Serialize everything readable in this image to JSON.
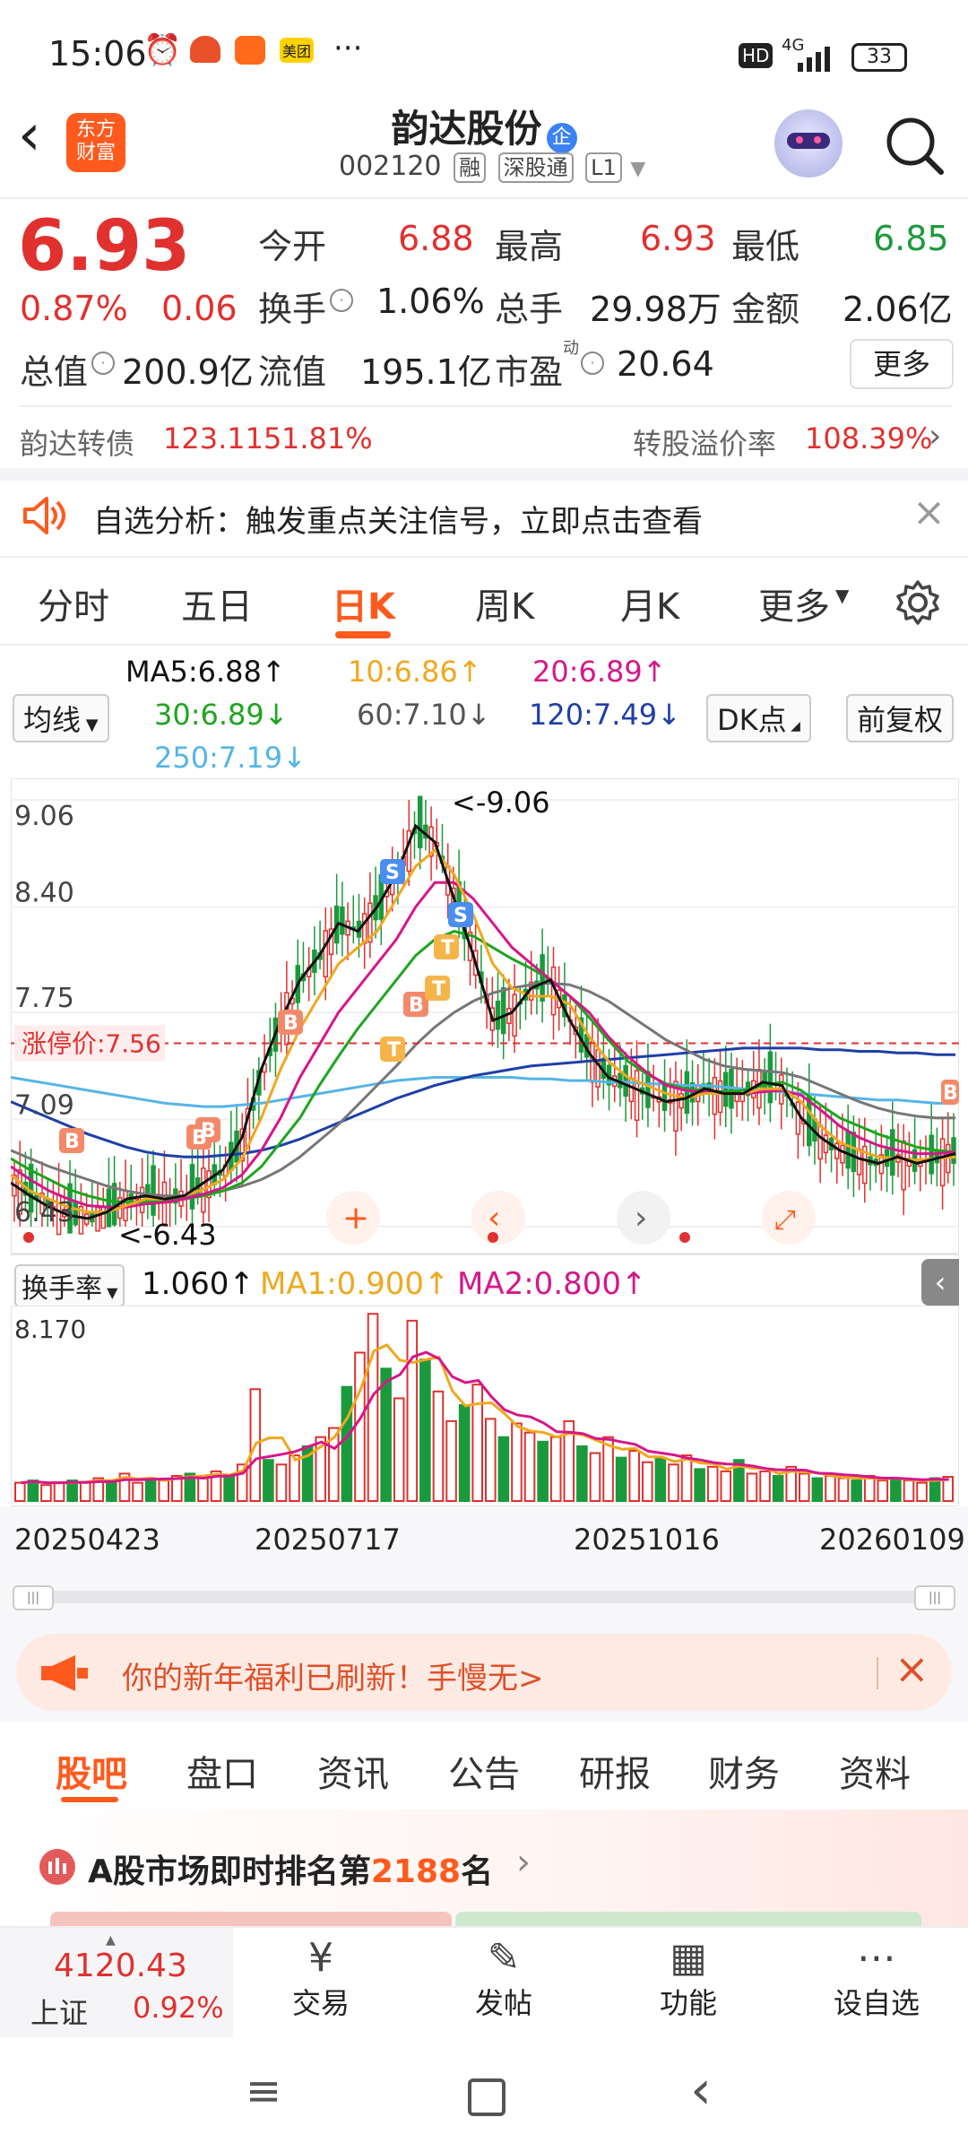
{
  "status_bar": {
    "time": "15:06",
    "meituan": "美团",
    "more": "···",
    "hd": "HD",
    "network": "4G",
    "battery": "33"
  },
  "header": {
    "logo_line1": "东方",
    "logo_line2": "财富",
    "title": "韵达股份",
    "badge": "企",
    "code": "002120",
    "tags": [
      "融",
      "深股通",
      "L1"
    ]
  },
  "quote": {
    "price": "6.93",
    "change_pct": "0.87%",
    "change": "0.06",
    "open_label": "今开",
    "open": "6.88",
    "high_label": "最高",
    "high": "6.93",
    "low_label": "最低",
    "low": "6.85",
    "turnover_label": "换手",
    "turnover": "1.06%",
    "volume_label": "总手",
    "volume": "29.98万",
    "amount_label": "金额",
    "amount": "2.06亿",
    "mktcap_label": "总值",
    "mktcap": "200.9亿",
    "float_label": "流值",
    "float": "195.1亿",
    "pe_label": "市盈",
    "pe_sup": "动",
    "pe": "20.64",
    "more_button": "更多"
  },
  "bond": {
    "name": "韵达转债",
    "price": "123.115",
    "pct": "1.81%",
    "premium_label": "转股溢价率",
    "premium": "108.39%"
  },
  "notice": {
    "text": "自选分析：触发重点关注信号，立即点击查看"
  },
  "period_tabs": [
    "分时",
    "五日",
    "日K",
    "周K",
    "月K",
    "更多"
  ],
  "active_tab": "日K",
  "ma_legend": {
    "select": "均线",
    "ma5": "MA5:6.88↑",
    "ma10": "10:6.86↑",
    "ma20": "20:6.89↑",
    "ma30": "30:6.89↓",
    "ma60": "60:7.10↓",
    "ma120": "120:7.49↓",
    "ma250": "250:7.19↓",
    "dk_button": "DK点",
    "adjust_button": "前复权"
  },
  "colors": {
    "ma5": "#111111",
    "ma10": "#f0a81e",
    "ma20": "#d6178a",
    "ma30": "#1ea51e",
    "ma60": "#777777",
    "ma120": "#1f3fa8",
    "ma250": "#55b5e6",
    "accent": "#ff5a1e",
    "up": "#e0312f",
    "down": "#1a9a3c"
  },
  "chart_data": [
    {
      "type": "candlestick",
      "y_ticks": [
        "9.06",
        "8.40",
        "7.75",
        "7.09",
        "6.43"
      ],
      "ylim": [
        6.43,
        9.06
      ],
      "limit_label": "涨停价:7.56",
      "limit_price": 7.56,
      "max_label": "<-9.06",
      "min_label": "<-6.43",
      "x_labels": [
        "20250423",
        "20250717",
        "20251016",
        "20260109"
      ],
      "series": [
        {
          "name": "MA5",
          "color": "#111111",
          "values": [
            6.7,
            6.62,
            6.55,
            6.5,
            6.48,
            6.52,
            6.6,
            6.62,
            6.6,
            6.62,
            6.7,
            6.78,
            6.98,
            7.4,
            7.7,
            7.95,
            8.1,
            8.3,
            8.25,
            8.4,
            8.6,
            8.9,
            8.8,
            8.45,
            8.1,
            7.7,
            7.75,
            7.9,
            7.95,
            7.7,
            7.5,
            7.35,
            7.3,
            7.25,
            7.2,
            7.22,
            7.28,
            7.25,
            7.25,
            7.32,
            7.3,
            7.1,
            6.98,
            6.9,
            6.85,
            6.82,
            6.86,
            6.82,
            6.85,
            6.88
          ]
        },
        {
          "name": "10",
          "color": "#f0a81e",
          "values": [
            6.75,
            6.65,
            6.6,
            6.55,
            6.52,
            6.52,
            6.56,
            6.6,
            6.6,
            6.62,
            6.66,
            6.72,
            6.85,
            7.1,
            7.4,
            7.65,
            7.85,
            8.05,
            8.15,
            8.25,
            8.45,
            8.65,
            8.75,
            8.6,
            8.35,
            8.05,
            7.9,
            7.85,
            7.85,
            7.8,
            7.6,
            7.45,
            7.35,
            7.3,
            7.25,
            7.22,
            7.25,
            7.25,
            7.25,
            7.28,
            7.28,
            7.2,
            7.05,
            6.95,
            6.9,
            6.86,
            6.85,
            6.84,
            6.85,
            6.86
          ]
        },
        {
          "name": "20",
          "color": "#d6178a",
          "values": [
            6.8,
            6.72,
            6.65,
            6.6,
            6.56,
            6.55,
            6.55,
            6.57,
            6.58,
            6.6,
            6.63,
            6.67,
            6.75,
            6.9,
            7.1,
            7.35,
            7.55,
            7.75,
            7.9,
            8.05,
            8.2,
            8.4,
            8.55,
            8.55,
            8.45,
            8.3,
            8.15,
            8.05,
            7.95,
            7.85,
            7.75,
            7.6,
            7.48,
            7.38,
            7.3,
            7.27,
            7.26,
            7.25,
            7.25,
            7.26,
            7.27,
            7.24,
            7.15,
            7.05,
            6.98,
            6.93,
            6.9,
            6.88,
            6.88,
            6.89
          ]
        },
        {
          "name": "30",
          "color": "#1ea51e",
          "values": [
            6.85,
            6.78,
            6.72,
            6.66,
            6.62,
            6.59,
            6.58,
            6.58,
            6.59,
            6.6,
            6.62,
            6.65,
            6.7,
            6.8,
            6.95,
            7.1,
            7.3,
            7.48,
            7.65,
            7.8,
            7.95,
            8.1,
            8.2,
            8.25,
            8.22,
            8.15,
            8.08,
            8.02,
            7.95,
            7.85,
            7.72,
            7.58,
            7.45,
            7.37,
            7.31,
            7.28,
            7.27,
            7.26,
            7.27,
            7.3,
            7.32,
            7.27,
            7.18,
            7.1,
            7.05,
            7.0,
            6.96,
            6.92,
            6.9,
            6.89
          ]
        },
        {
          "name": "60",
          "color": "#777777",
          "values": [
            6.9,
            6.85,
            6.8,
            6.76,
            6.72,
            6.68,
            6.65,
            6.63,
            6.62,
            6.62,
            6.63,
            6.65,
            6.68,
            6.72,
            6.78,
            6.86,
            6.96,
            7.06,
            7.18,
            7.3,
            7.42,
            7.55,
            7.66,
            7.75,
            7.82,
            7.87,
            7.9,
            7.92,
            7.93,
            7.92,
            7.88,
            7.82,
            7.74,
            7.66,
            7.58,
            7.52,
            7.46,
            7.42,
            7.4,
            7.39,
            7.38,
            7.35,
            7.3,
            7.25,
            7.2,
            7.16,
            7.13,
            7.11,
            7.1,
            7.1
          ]
        },
        {
          "name": "120",
          "color": "#1f3fa8",
          "values": [
            7.2,
            7.15,
            7.1,
            7.05,
            7.0,
            6.96,
            6.92,
            6.89,
            6.87,
            6.86,
            6.86,
            6.87,
            6.88,
            6.9,
            6.93,
            6.97,
            7.02,
            7.07,
            7.12,
            7.17,
            7.22,
            7.26,
            7.3,
            7.33,
            7.36,
            7.38,
            7.4,
            7.42,
            7.43,
            7.44,
            7.45,
            7.46,
            7.47,
            7.48,
            7.49,
            7.5,
            7.51,
            7.52,
            7.53,
            7.53,
            7.53,
            7.53,
            7.52,
            7.52,
            7.51,
            7.51,
            7.5,
            7.5,
            7.49,
            7.49
          ]
        },
        {
          "name": "250",
          "color": "#55b5e6",
          "values": [
            7.35,
            7.33,
            7.31,
            7.29,
            7.27,
            7.25,
            7.23,
            7.21,
            7.19,
            7.18,
            7.17,
            7.17,
            7.18,
            7.19,
            7.21,
            7.23,
            7.25,
            7.27,
            7.29,
            7.31,
            7.33,
            7.34,
            7.35,
            7.35,
            7.35,
            7.35,
            7.35,
            7.34,
            7.34,
            7.33,
            7.33,
            7.32,
            7.32,
            7.31,
            7.31,
            7.3,
            7.3,
            7.29,
            7.28,
            7.27,
            7.26,
            7.25,
            7.24,
            7.23,
            7.22,
            7.21,
            7.21,
            7.2,
            7.19,
            7.19
          ]
        }
      ]
    },
    {
      "type": "bar",
      "title": "换手率",
      "value": "1.060↑",
      "ma1": "MA1:0.900↑",
      "ma2": "MA2:0.800↑",
      "y_ticks": [
        "8.170"
      ],
      "ylim": [
        0,
        8.17
      ],
      "values": [
        0.8,
        0.9,
        0.7,
        0.8,
        0.9,
        0.8,
        1.0,
        0.9,
        1.2,
        0.8,
        1.0,
        0.9,
        1.1,
        1.2,
        1.0,
        1.3,
        1.1,
        1.6,
        4.9,
        1.8,
        1.6,
        2.0,
        2.4,
        2.8,
        3.2,
        5.0,
        6.5,
        8.2,
        5.8,
        4.5,
        7.9,
        6.2,
        4.8,
        3.5,
        4.2,
        5.1,
        3.6,
        2.8,
        3.4,
        3.0,
        2.6,
        2.8,
        3.5,
        2.4,
        2.1,
        2.8,
        1.9,
        2.2,
        1.7,
        1.9,
        1.6,
        2.0,
        1.4,
        1.5,
        1.3,
        1.8,
        1.2,
        1.3,
        1.1,
        1.5,
        1.2,
        1.0,
        1.1,
        1.0,
        0.9,
        1.1,
        0.9,
        1.0,
        0.9,
        0.8,
        1.0,
        1.06
      ]
    }
  ],
  "promo": {
    "text": "你的新年福利已刷新！手慢无>"
  },
  "bottom_tabs": [
    "股吧",
    "盘口",
    "资讯",
    "公告",
    "研报",
    "财务",
    "资料"
  ],
  "ranking": {
    "prefix": "A股市场即时排名第",
    "rank": "2188",
    "suffix": "名"
  },
  "footer": {
    "index_value": "4120.43",
    "index_name": "上证",
    "index_pct": "0.92%",
    "trade": "交易",
    "post": "发帖",
    "function": "功能",
    "watch": "设自选"
  }
}
